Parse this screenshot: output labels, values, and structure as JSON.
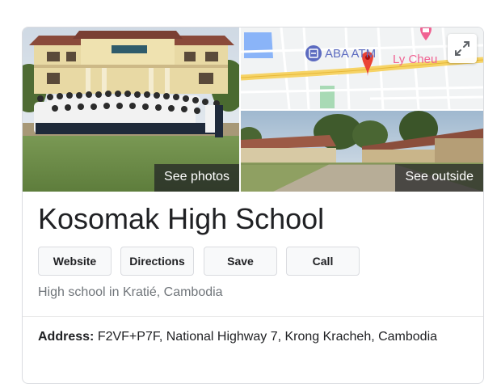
{
  "media": {
    "see_photos_label": "See photos",
    "see_outside_label": "See outside",
    "map": {
      "place_1": "ABA ATM",
      "place_2": "Ly Cheu"
    }
  },
  "place": {
    "title": "Kosomak High School",
    "subtitle": "High school in Kratié, Cambodia"
  },
  "actions": [
    {
      "label": "Website"
    },
    {
      "label": "Directions"
    },
    {
      "label": "Save"
    },
    {
      "label": "Call"
    }
  ],
  "address": {
    "label": "Address:",
    "value": "F2VF+P7F, National Highway 7, Krong Kracheh, Cambodia"
  },
  "colors": {
    "map_road": "#f6d365",
    "map_water": "#8ab4f8",
    "map_park": "#a8dab5",
    "map_pin": "#ea4335",
    "map_poi_pink": "#f06292",
    "map_atm_blue": "#5c6bc0"
  },
  "icons": [
    "expand-icon",
    "map-pin-icon",
    "atm-icon",
    "hotel-icon"
  ]
}
